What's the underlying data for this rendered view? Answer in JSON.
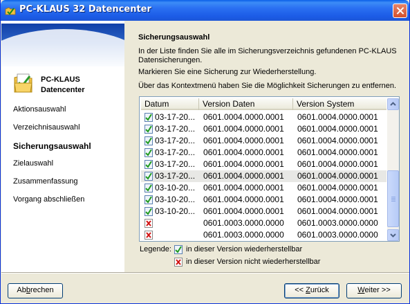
{
  "window": {
    "title": "PC-KLAUS 32 Datencenter"
  },
  "sidebar": {
    "brand_line1": "PC-KLAUS",
    "brand_line2": "Datencenter",
    "steps": [
      {
        "label": "Aktionsauswahl",
        "active": false
      },
      {
        "label": "Verzeichnisauswahl",
        "active": false
      },
      {
        "label": "Sicherungsauswahl",
        "active": true
      },
      {
        "label": "Zielauswahl",
        "active": false
      },
      {
        "label": "Zusammenfassung",
        "active": false
      },
      {
        "label": "Vorgang abschließen",
        "active": false
      }
    ]
  },
  "main": {
    "heading": "Sicherungsauswahl",
    "para1_line1": "In der Liste finden Sie alle im Sicherungsverzeichnis gefundenen PC-KLAUS",
    "para1_line2": "Datensicherungen.",
    "para2": "Markieren Sie eine Sicherung zur Wiederherstellung.",
    "para3": "Über das Kontextmenü haben Sie die Möglichkeit Sicherungen zu entfernen."
  },
  "list": {
    "columns": [
      "Datum",
      "Version Daten",
      "Version System"
    ],
    "rows": [
      {
        "status": "ok",
        "datum": "03-17-20...",
        "daten": "0601.0004.0000.0001",
        "system": "0601.0004.0000.0001",
        "selected": false
      },
      {
        "status": "ok",
        "datum": "03-17-20...",
        "daten": "0601.0004.0000.0001",
        "system": "0601.0004.0000.0001",
        "selected": false
      },
      {
        "status": "ok",
        "datum": "03-17-20...",
        "daten": "0601.0004.0000.0001",
        "system": "0601.0004.0000.0001",
        "selected": false
      },
      {
        "status": "ok",
        "datum": "03-17-20...",
        "daten": "0601.0004.0000.0001",
        "system": "0601.0004.0000.0001",
        "selected": false
      },
      {
        "status": "ok",
        "datum": "03-17-20...",
        "daten": "0601.0004.0000.0001",
        "system": "0601.0004.0000.0001",
        "selected": false
      },
      {
        "status": "ok",
        "datum": "03-17-20...",
        "daten": "0601.0004.0000.0001",
        "system": "0601.0004.0000.0001",
        "selected": true
      },
      {
        "status": "ok",
        "datum": "03-10-20...",
        "daten": "0601.0004.0000.0001",
        "system": "0601.0004.0000.0001",
        "selected": false
      },
      {
        "status": "ok",
        "datum": "03-10-20...",
        "daten": "0601.0004.0000.0001",
        "system": "0601.0004.0000.0001",
        "selected": false
      },
      {
        "status": "ok",
        "datum": "03-10-20...",
        "daten": "0601.0004.0000.0001",
        "system": "0601.0004.0000.0001",
        "selected": false
      },
      {
        "status": "error",
        "datum": "",
        "daten": "0601.0003.0000.0000",
        "system": "0601.0003.0000.0000",
        "selected": false
      },
      {
        "status": "error",
        "datum": "",
        "daten": "0601.0003.0000.0000",
        "system": "0601.0003.0000.0000",
        "selected": false
      }
    ]
  },
  "legend": {
    "label": "Legende:",
    "ok_text": "in dieser Version wiederherstellbar",
    "error_text": "in dieser Version nicht wiederherstellbar"
  },
  "buttons": {
    "cancel": {
      "prefix": "Ab",
      "mnemonic": "b",
      "suffix": "rechen"
    },
    "back": {
      "prefix": "<< ",
      "mnemonic": "Z",
      "suffix": "urück"
    },
    "next": {
      "prefix": "",
      "mnemonic": "W",
      "suffix": "eiter >>"
    }
  },
  "icons": {
    "ok": "check-document-icon",
    "error": "red-x-icon"
  },
  "colors": {
    "titlebar": "#1b5be6",
    "selection_row": "#e8e8e5",
    "list_border": "#7f9db9"
  }
}
